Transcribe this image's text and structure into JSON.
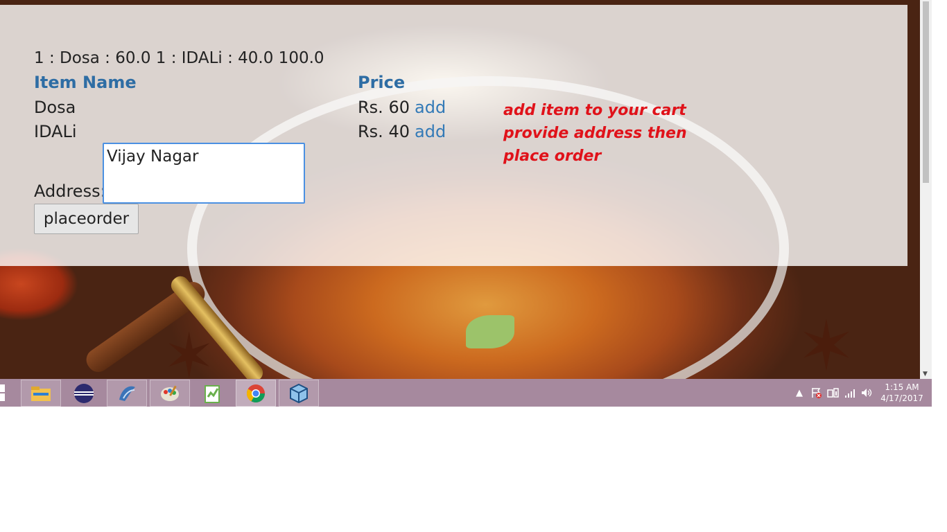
{
  "page": {
    "cart_summary": "1 : Dosa : 60.0 1 : IDALi : 40.0 100.0",
    "columns": {
      "item_name": "Item Name",
      "price": "Price"
    },
    "items": [
      {
        "name": "Dosa",
        "price": "Rs. 60",
        "action": "add"
      },
      {
        "name": "IDALi",
        "price": "Rs. 40",
        "action": "add"
      }
    ],
    "hint_lines": [
      "add item to your cart",
      "provide address then",
      "place order"
    ],
    "address_label": "Address:",
    "address_value": "Vijay Nagar",
    "place_order_label": "placeorder"
  },
  "taskbar": {
    "apps": [
      "file-explorer-icon",
      "eclipse-icon",
      "mysql-workbench-icon",
      "paint-icon",
      "notepad-plus-plus-icon",
      "chrome-icon",
      "virtualbox-icon"
    ],
    "clock_time": "1:15 AM",
    "clock_date": "4/17/2017"
  },
  "colors": {
    "accent": "#2e6da4",
    "link": "#337ab7",
    "hint": "#e0121a",
    "taskbar": "#a6899e"
  }
}
